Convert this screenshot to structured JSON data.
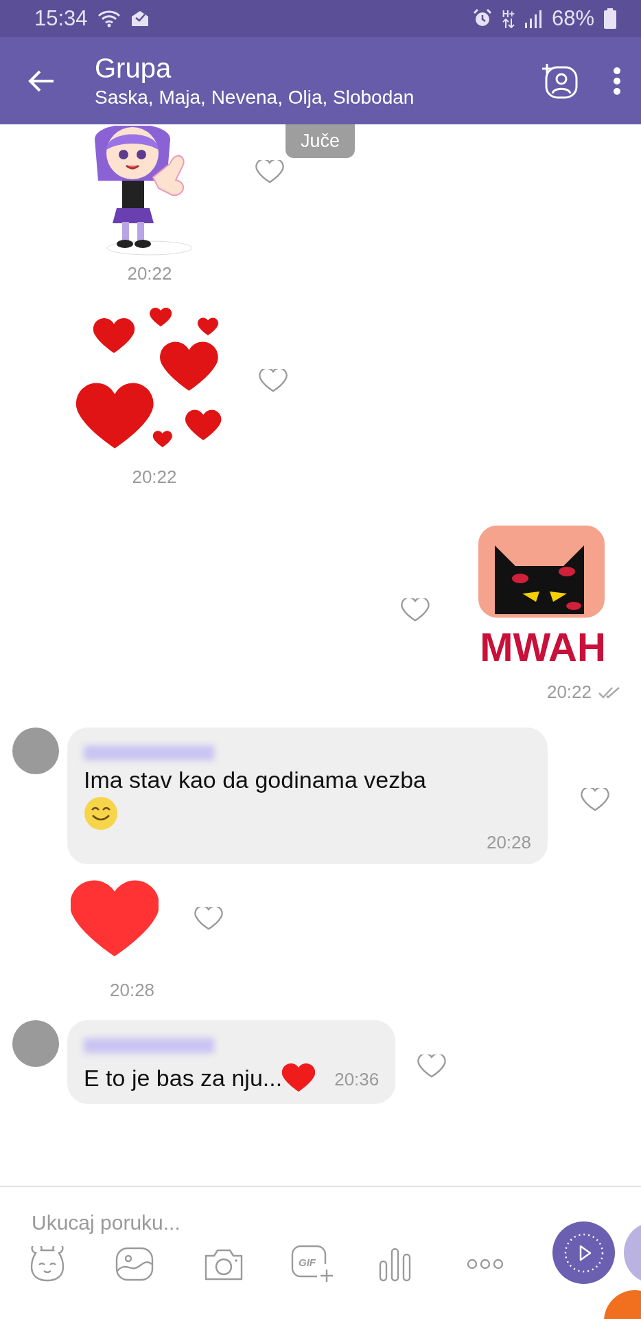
{
  "status_bar": {
    "time": "15:34",
    "network": "H+",
    "battery": "68%"
  },
  "header": {
    "title": "Grupa",
    "subtitle": "Saska, Maja, Nevena, Olja, Slobodan"
  },
  "date_pill": "Juče",
  "messages": [
    {
      "kind": "sticker",
      "sticker": {
        "kind": "girl"
      },
      "outgoing": false,
      "time": "20:22",
      "liked": false
    },
    {
      "kind": "sticker",
      "sticker": {
        "kind": "hearts"
      },
      "outgoing": false,
      "time": "20:22",
      "liked": false
    },
    {
      "kind": "sticker",
      "sticker": {
        "kind": "cat"
      },
      "caption": "MWAH",
      "outgoing": true,
      "time": "20:22",
      "liked": false
    },
    {
      "kind": "text",
      "outgoing": false,
      "avatar": true,
      "text": "Ima stav kao da godinama vezba",
      "emoji": {
        "kind": "smile"
      },
      "time": "20:28",
      "liked": false
    },
    {
      "kind": "emoji",
      "emoji": {
        "kind": "heart"
      },
      "outgoing": false,
      "time": "20:28",
      "liked": false
    },
    {
      "kind": "text",
      "outgoing": false,
      "avatar": true,
      "text": "E to je bas za nju...",
      "emoji": {
        "kind": "heart"
      },
      "time": "20:36",
      "liked": false
    }
  ],
  "composer": {
    "placeholder": "Ukucaj poruku...",
    "gif_label": "GIF"
  }
}
